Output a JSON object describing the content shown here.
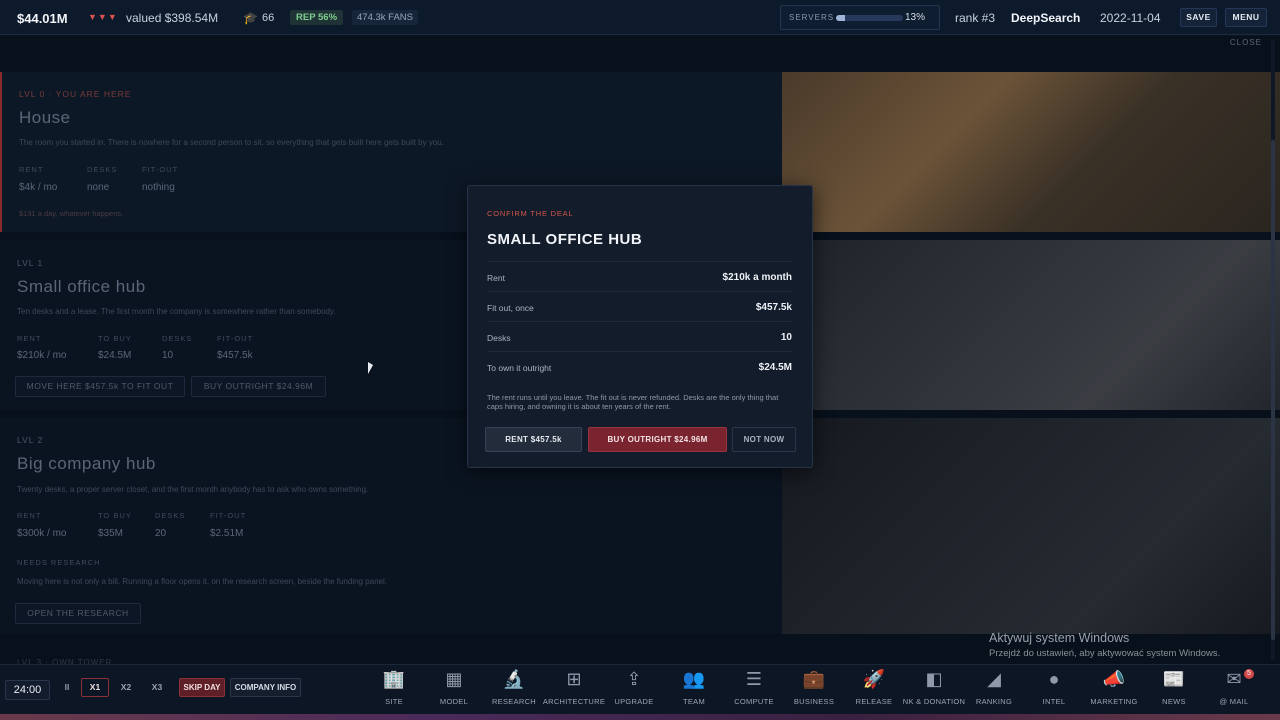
{
  "topbar": {
    "money": "$44.01M",
    "trend_arrows": "▼▼▼",
    "valued": "valued $398.54M",
    "researchers_count": "66",
    "rep": "REP 56%",
    "fans": "474.3k FANS",
    "servers_label": "SERVERS",
    "servers_pct": "13%",
    "servers_value": 0.13,
    "rank": "rank #3",
    "company": "DeepSearch",
    "date": "2022-11-04",
    "save_label": "SAVE",
    "menu_label": "MENU"
  },
  "panel": {
    "close_label": "CLOSE",
    "rows": [
      {
        "level": "LVL 0 · YOU ARE HERE",
        "title": "House",
        "desc": "The room you started in. There is nowhere for a second person to sit, so everything that gets built here gets built by you.",
        "stats": [
          {
            "label": "RENT",
            "value": "$4k / mo"
          },
          {
            "label": "DESKS",
            "value": "none"
          },
          {
            "label": "FIT-OUT",
            "value": "nothing"
          }
        ],
        "note": "$131 a day, whatever happens."
      },
      {
        "level": "LVL 1",
        "title": "Small office hub",
        "desc": "Ten desks and a lease. The first month the company is somewhere rather than somebody.",
        "stats": [
          {
            "label": "RENT",
            "value": "$210k / mo"
          },
          {
            "label": "TO BUY",
            "value": "$24.5M"
          },
          {
            "label": "DESKS",
            "value": "10"
          },
          {
            "label": "FIT-OUT",
            "value": "$457.5k"
          }
        ],
        "btn_move": "MOVE HERE $457.5k TO FIT OUT",
        "btn_buy": "BUY OUTRIGHT $24.96M"
      },
      {
        "level": "LVL 2",
        "title": "Big company hub",
        "desc": "Twenty desks, a proper server closet, and the first month anybody has to ask who owns something.",
        "stats": [
          {
            "label": "RENT",
            "value": "$300k / mo"
          },
          {
            "label": "TO BUY",
            "value": "$35M"
          },
          {
            "label": "DESKS",
            "value": "20"
          },
          {
            "label": "FIT-OUT",
            "value": "$2.51M"
          }
        ],
        "needs": "NEEDS RESEARCH",
        "needs_desc": "Moving here is not only a bill. Running a floor opens it, on the research screen, beside the funding panel.",
        "btn_research": "OPEN THE RESEARCH"
      }
    ],
    "next_row": "LVL 3 · OWN TOWER"
  },
  "modal": {
    "eyebrow": "CONFIRM THE DEAL",
    "title": "SMALL OFFICE HUB",
    "rows": [
      {
        "label": "Rent",
        "value": "$210k a month"
      },
      {
        "label": "Fit out, once",
        "value": "$457.5k"
      },
      {
        "label": "Desks",
        "value": "10"
      },
      {
        "label": "To own it outright",
        "value": "$24.5M"
      }
    ],
    "desc": "The rent runs until you leave. The fit out is never refunded. Desks are the only thing that caps hiring, and owning it is about ten years of the rent.",
    "btn_rent": "RENT $457.5k",
    "btn_buy": "BUY OUTRIGHT $24.96M",
    "btn_not": "NOT NOW"
  },
  "bottombar": {
    "clock": "24:00",
    "pause": "II",
    "x1": "X1",
    "x2": "X2",
    "x3": "X3",
    "skip_day": "SKIP DAY",
    "company_info": "COMPANY INFO",
    "nav": [
      {
        "label": "SITE",
        "icon": "building-icon"
      },
      {
        "label": "MODEL",
        "icon": "chip-icon"
      },
      {
        "label": "RESEARCH",
        "icon": "microscope-icon"
      },
      {
        "label": "ARCHITECTURE",
        "icon": "hierarchy-icon"
      },
      {
        "label": "UPGRADE",
        "icon": "upgrade-icon"
      },
      {
        "label": "TEAM",
        "icon": "team-icon"
      },
      {
        "label": "COMPUTE",
        "icon": "server-icon"
      },
      {
        "label": "BUSINESS",
        "icon": "briefcase-icon"
      },
      {
        "label": "RELEASE",
        "icon": "rocket-icon"
      },
      {
        "label": "NK & DONATION",
        "icon": "donation-icon"
      },
      {
        "label": "RANKING",
        "icon": "ranking-icon"
      },
      {
        "label": "INTEL",
        "icon": "globe-icon"
      },
      {
        "label": "MARKETING",
        "icon": "megaphone-icon"
      },
      {
        "label": "NEWS",
        "icon": "newspaper-icon"
      },
      {
        "label": "@ MAIL",
        "icon": "mail-icon",
        "badge": "5"
      }
    ]
  },
  "watermark": {
    "line1": "Aktywuj system Windows",
    "line2": "Przejdź do ustawień, aby aktywować system Windows."
  }
}
